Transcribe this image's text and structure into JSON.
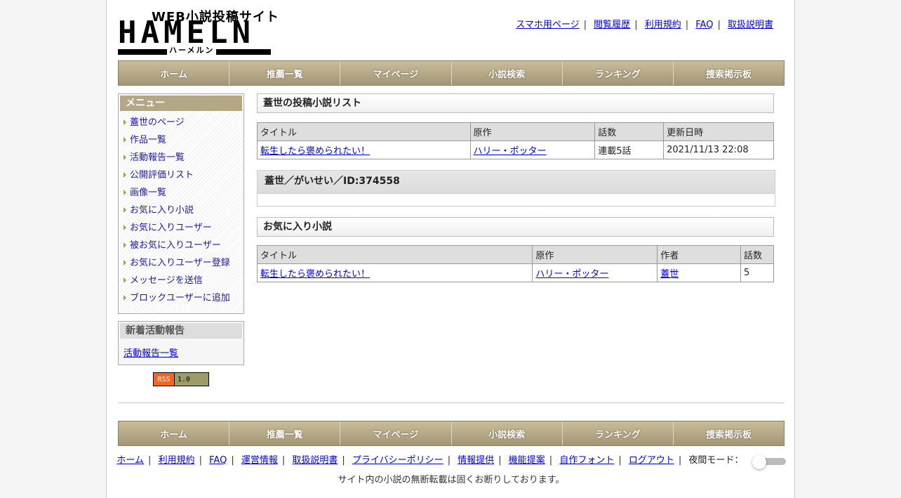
{
  "logo": {
    "top_text": "WEB小説投稿サイト",
    "main_text": "HAMELN",
    "kana": "ハーメルン"
  },
  "top_links": [
    "スマホ用ページ",
    "閲覧履歴",
    "利用規約",
    "FAQ",
    "取扱説明書"
  ],
  "nav": [
    "ホーム",
    "推薦一覧",
    "マイページ",
    "小説検索",
    "ランキング",
    "捜索掲示板"
  ],
  "sidebar": {
    "menu_title": "メニュー",
    "menu_items": [
      "蓋世のページ",
      "作品一覧",
      "活動報告一覧",
      "公開評価リスト",
      "画像一覧",
      "お気に入り小説",
      "お気に入りユーザー",
      "被お気に入りユーザー",
      "お気に入りユーザー登録",
      "メッセージを送信",
      "ブロックユーザーに追加"
    ],
    "news_title": "新着活動報告",
    "news_link": "活動報告一覧",
    "rss": {
      "left": "RSS",
      "right": "1.0",
      "accent": "#f26522"
    }
  },
  "main": {
    "novels_title": "蓋世の投稿小説リスト",
    "novels_table": {
      "headers": [
        "タイトル",
        "原作",
        "話数",
        "更新日時"
      ],
      "rows": [
        [
          "転生したら褒められたい！",
          "ハリー・ポッター",
          "連載5話",
          "2021/11/13 22:08"
        ]
      ]
    },
    "profile_title": "蓋世／がいせい／ID:374558",
    "fav_title": "お気に入り小説",
    "fav_table": {
      "headers": [
        "タイトル",
        "原作",
        "作者",
        "話数"
      ],
      "rows": [
        [
          "転生したら褒められたい！",
          "ハリー・ポッター",
          "蓋世",
          "5"
        ]
      ]
    }
  },
  "footer": {
    "links": [
      "ホーム",
      "利用規約",
      "FAQ",
      "運営情報",
      "取扱説明書",
      "プライバシーポリシー",
      "情報提供",
      "機能提案",
      "自作フォント",
      "ログアウト"
    ],
    "night_mode_label": "夜間モード：",
    "notice": "サイト内の小説の無断転載は固くお断りしております。"
  },
  "colors": {
    "nav": "#b3a785",
    "link": "#0000ee"
  }
}
